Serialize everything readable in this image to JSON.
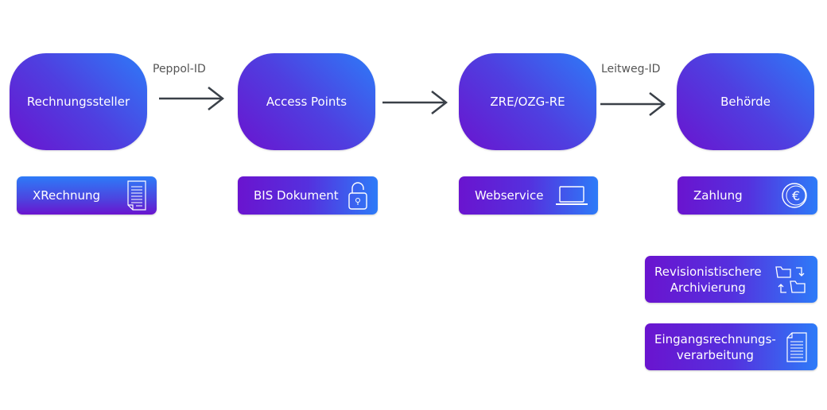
{
  "nodes": [
    "Rechnungssteller",
    "Access Points",
    "ZRE/OZG-RE",
    "Behörde"
  ],
  "edge_labels": {
    "first": "Peppol-ID",
    "third": "Leitweg-ID"
  },
  "cards": [
    {
      "label": "XRechnung",
      "icon": "document-icon"
    },
    {
      "label": "BIS Dokument",
      "icon": "lock-icon"
    },
    {
      "label": "Webservice",
      "icon": "laptop-icon"
    },
    {
      "label": "Zahlung",
      "icon": "euro-coin-icon"
    },
    {
      "line1": "Revisionistischere",
      "line2": "Archivierung",
      "icon": "folder-sync-icon"
    },
    {
      "line1": "Eingangsrechnungs-",
      "line2": "verarbeitung",
      "icon": "document-icon"
    }
  ],
  "colors": {
    "purple": "#6a14cf",
    "blue": "#2d7bf8",
    "arrow": "#3a4048"
  }
}
